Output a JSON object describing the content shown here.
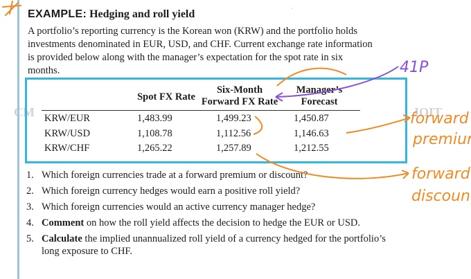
{
  "example": {
    "label": "EXAMPLE:",
    "title": "Hedging and roll yield",
    "intro": "A portfolio’s reporting currency is the Korean won (KRW) and the portfolio holds investments denominated in EUR, USD, and CHF. Current exchange rate information is provided below along with the manager’s expectation for the spot rate in six months."
  },
  "table": {
    "headers": {
      "spot": "Spot FX Rate",
      "forward_line1": "Six-Month",
      "forward_line2": "Forward FX Rate",
      "forecast_line1": "Manager’s",
      "forecast_line2": "Forecast"
    },
    "rows": [
      {
        "pair": "KRW/EUR",
        "spot": "1,483.99",
        "forward": "1,499.23",
        "forecast": "1,450.87"
      },
      {
        "pair": "KRW/USD",
        "spot": "1,108.78",
        "forward": "1,112.56",
        "forecast": "1,146.63"
      },
      {
        "pair": "KRW/CHF",
        "spot": "1,265.22",
        "forward": "1,257.89",
        "forecast": "1,212.55"
      }
    ]
  },
  "questions": [
    {
      "num": "1.",
      "bold": "",
      "text": "Which foreign currencies trade at a forward premium or discount?"
    },
    {
      "num": "2.",
      "bold": "",
      "text": "Which foreign currency hedges would earn a positive roll yield?"
    },
    {
      "num": "3.",
      "bold": "",
      "text": "Which foreign currencies would an active currency manager hedge?"
    },
    {
      "num": "4.",
      "bold": "Comment",
      "text": " on how the roll yield affects the decision to hedge the EUR or USD."
    },
    {
      "num": "5.",
      "bold": "Calculate",
      "text": " the implied unannualized roll yield of a currency hedged for the portfolio’s long exposure to CHF."
    }
  ],
  "annotations": {
    "note_top": "41P",
    "forward_premium_1": "forward",
    "forward_premium_2": "premium",
    "forward_discount_1": "forward",
    "forward_discount_2": "discount",
    "ink_orange": "#f08a24",
    "ink_purple": "#8a4fd8",
    "box_blue": "#35b6de"
  }
}
